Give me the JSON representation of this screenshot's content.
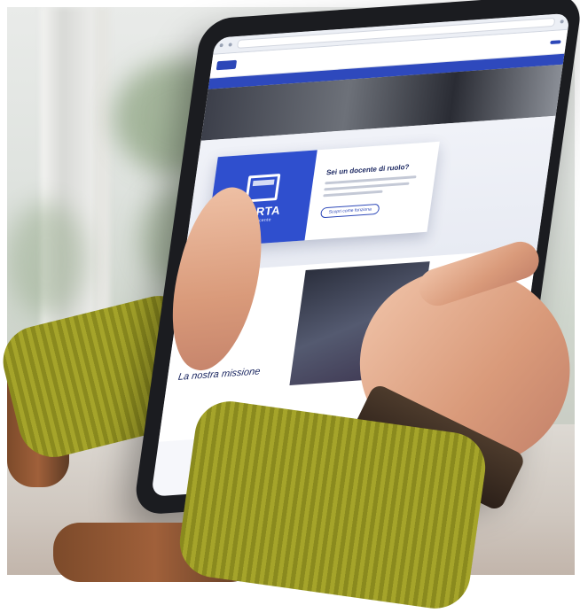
{
  "browser": {
    "address": ""
  },
  "site": {
    "nav": {
      "cta_label": ""
    },
    "card": {
      "logo_word": "CARTA",
      "logo_sub": "del docente",
      "question": "Sei un docente di ruolo?",
      "button_label": "Scopri come funziona"
    },
    "mission": {
      "title": "La nostra missione"
    }
  },
  "colors": {
    "brand_blue": "#2f4fce",
    "header_strip": "#2e49bd",
    "sweater_green": "#9a9a24"
  }
}
